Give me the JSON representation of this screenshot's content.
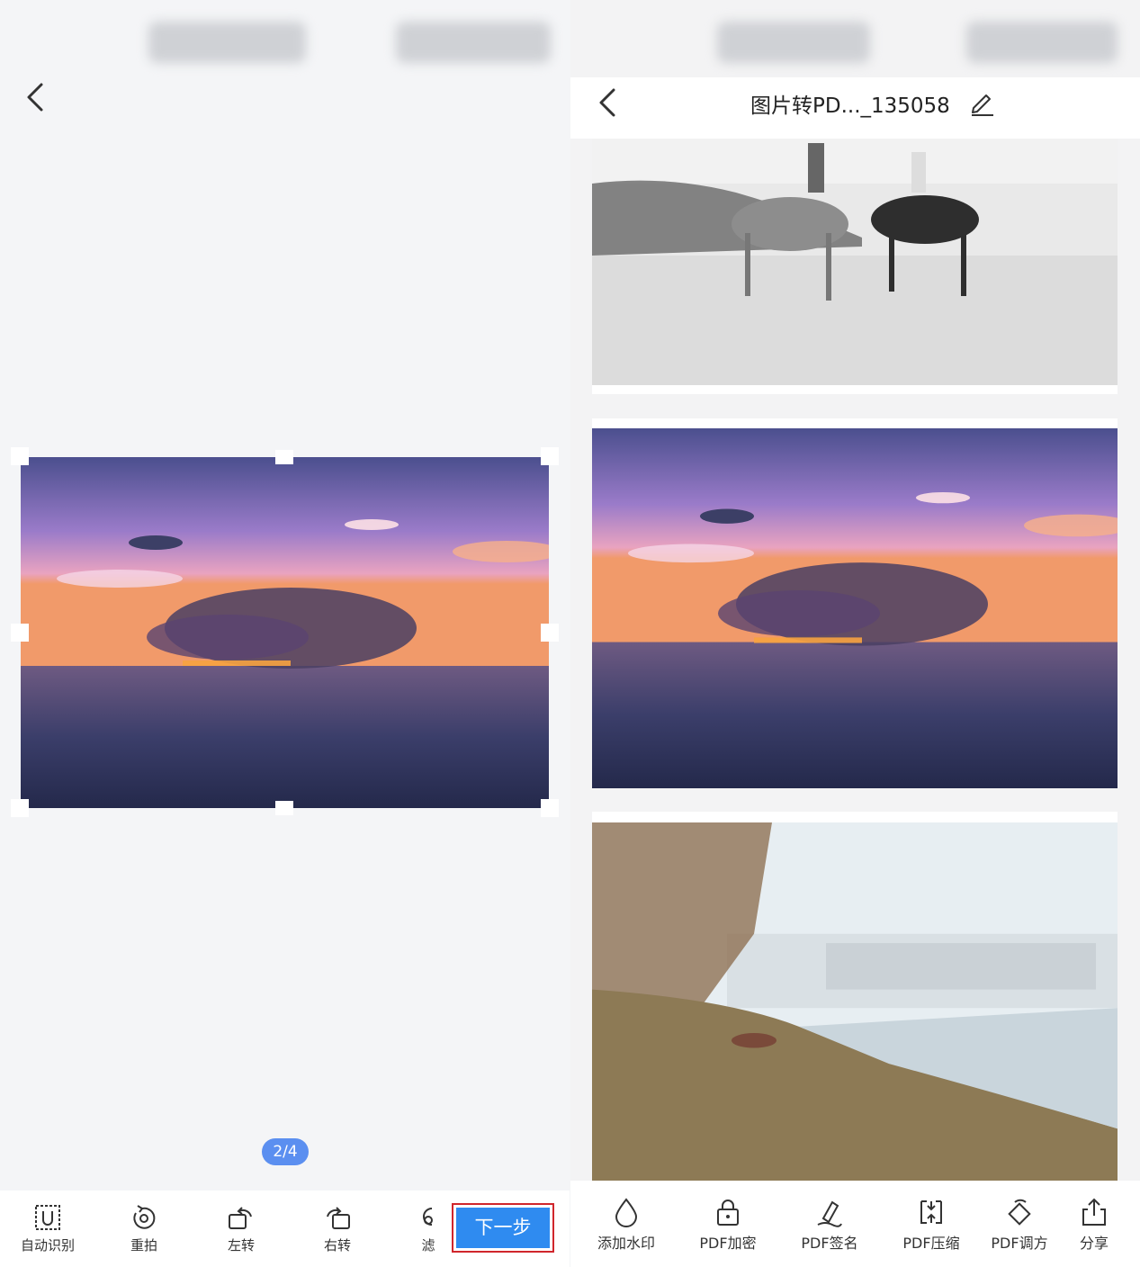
{
  "left_screen": {
    "page_indicator": "2/4",
    "toolbar": {
      "items": [
        {
          "label": "自动识别",
          "icon": "auto-detect-icon"
        },
        {
          "label": "重拍",
          "icon": "retake-icon"
        },
        {
          "label": "左转",
          "icon": "rotate-left-icon"
        },
        {
          "label": "右转",
          "icon": "rotate-right-icon"
        },
        {
          "label": "滤",
          "icon": "filter-icon"
        }
      ],
      "next_label": "下一步"
    }
  },
  "right_screen": {
    "header": {
      "title": "图片转PD..._135058"
    },
    "toolbar": {
      "items": [
        {
          "label": "添加水印",
          "icon": "watermark-icon"
        },
        {
          "label": "PDF加密",
          "icon": "lock-icon"
        },
        {
          "label": "PDF签名",
          "icon": "signature-icon"
        },
        {
          "label": "PDF压缩",
          "icon": "compress-icon"
        },
        {
          "label": "PDF调方",
          "icon": "adjust-direction-icon"
        },
        {
          "label": "分享",
          "icon": "share-icon"
        }
      ]
    }
  },
  "colors": {
    "accent": "#2f8bf0",
    "badge": "#5b8ff0",
    "highlight_border": "#d0262c"
  }
}
